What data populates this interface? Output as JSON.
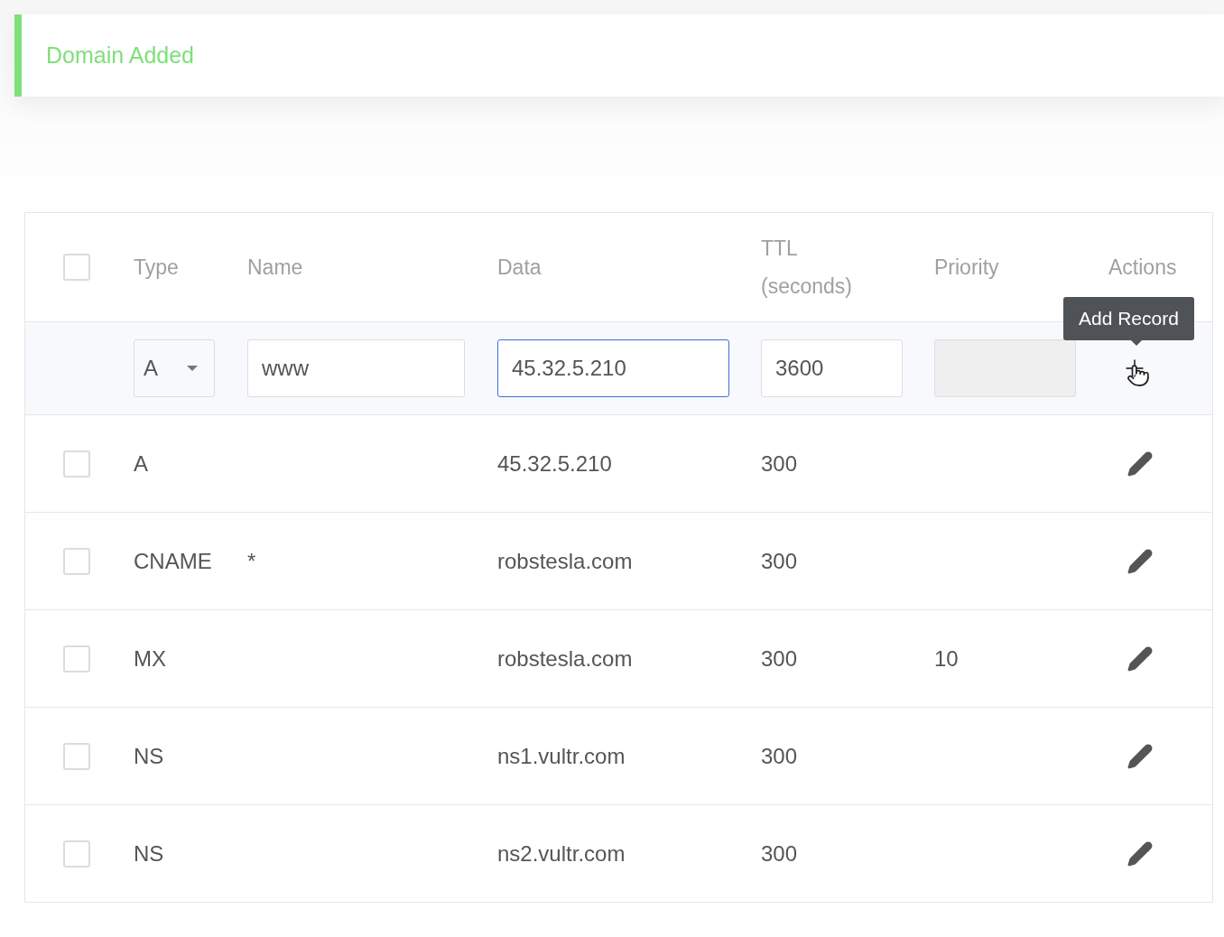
{
  "notification": {
    "message": "Domain Added"
  },
  "table": {
    "header_checkbox": {
      "checked": false
    },
    "columns": [
      "Type",
      "Name",
      "Data",
      "TTL (seconds)",
      "Priority",
      "Actions"
    ],
    "new_record": {
      "fields": [
        {
          "kind": "select",
          "value": "A"
        },
        {
          "kind": "input",
          "value": "www",
          "focused": false,
          "disabled": false
        },
        {
          "kind": "input",
          "value": "45.32.5.210",
          "focused": true,
          "disabled": false
        },
        {
          "kind": "input",
          "value": "3600",
          "focused": false,
          "disabled": false
        },
        {
          "kind": "input",
          "focused": false,
          "disabled": true
        }
      ],
      "tooltip": "Add Record"
    },
    "rows": [
      {
        "checked": false,
        "type": "A",
        "data": "45.32.5.210",
        "ttl": "300"
      },
      {
        "checked": false,
        "type": "CNAME",
        "name": "*",
        "data": "robstesla.com",
        "ttl": "300"
      },
      {
        "checked": false,
        "type": "MX",
        "data": "robstesla.com",
        "ttl": "300",
        "priority": "10"
      },
      {
        "checked": false,
        "type": "NS",
        "data": "ns1.vultr.com",
        "ttl": "300"
      },
      {
        "checked": false,
        "type": "NS",
        "data": "ns2.vultr.com",
        "ttl": "300"
      }
    ]
  }
}
